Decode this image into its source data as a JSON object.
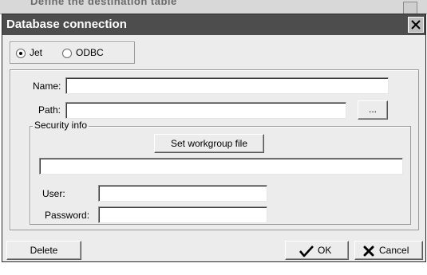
{
  "background_window": {
    "title": "Define the destination table"
  },
  "dialog": {
    "title": "Database connection",
    "connection_type": {
      "options": [
        "Jet",
        "ODBC"
      ],
      "selected": "Jet"
    },
    "name_label": "Name:",
    "name_value": "",
    "path_label": "Path:",
    "path_value": "",
    "browse_label": "...",
    "security": {
      "legend": "Security info",
      "set_workgroup_label": "Set workgroup file",
      "workgroup_file_value": "",
      "user_label": "User:",
      "user_value": "",
      "password_label": "Password:",
      "password_value": ""
    },
    "buttons": {
      "delete": "Delete",
      "ok": "OK",
      "cancel": "Cancel"
    }
  },
  "colors": {
    "titlebar": "#4d4d4d",
    "dialog_bg": "#ececec",
    "title_text": "#ffffff"
  }
}
